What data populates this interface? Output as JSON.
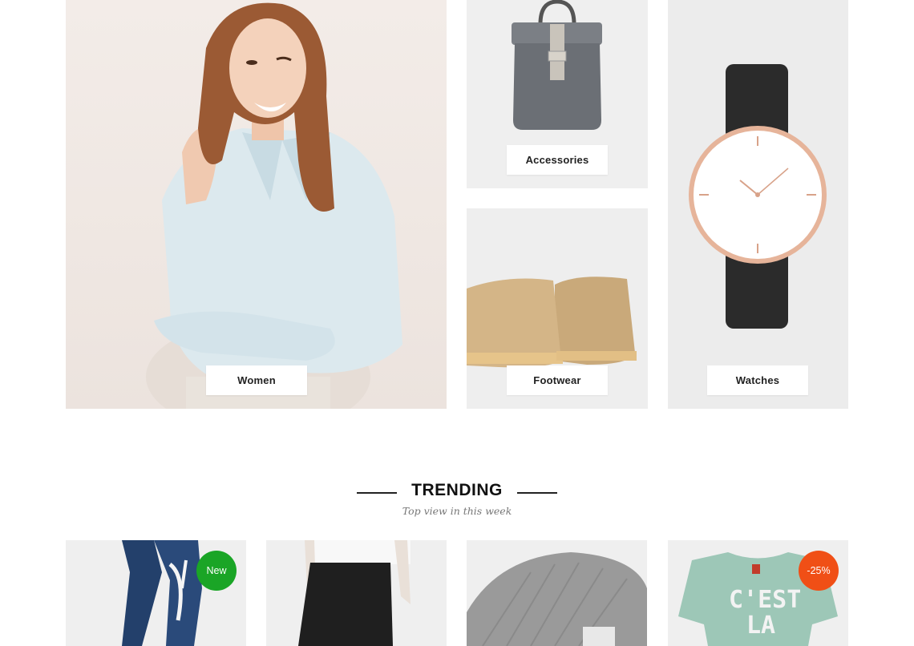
{
  "categories": [
    {
      "label": "Women"
    },
    {
      "label": "Accessories"
    },
    {
      "label": "Footwear"
    },
    {
      "label": "Watches"
    }
  ],
  "trending": {
    "title": "TRENDING",
    "subtitle": "Top view in this week"
  },
  "products": [
    {
      "badge": "New",
      "badge_color": "#1aa526"
    },
    {
      "badge": ""
    },
    {
      "badge": ""
    },
    {
      "badge": "-25%",
      "badge_color": "#f04f16",
      "shirt_text": "C'EST LA"
    }
  ]
}
